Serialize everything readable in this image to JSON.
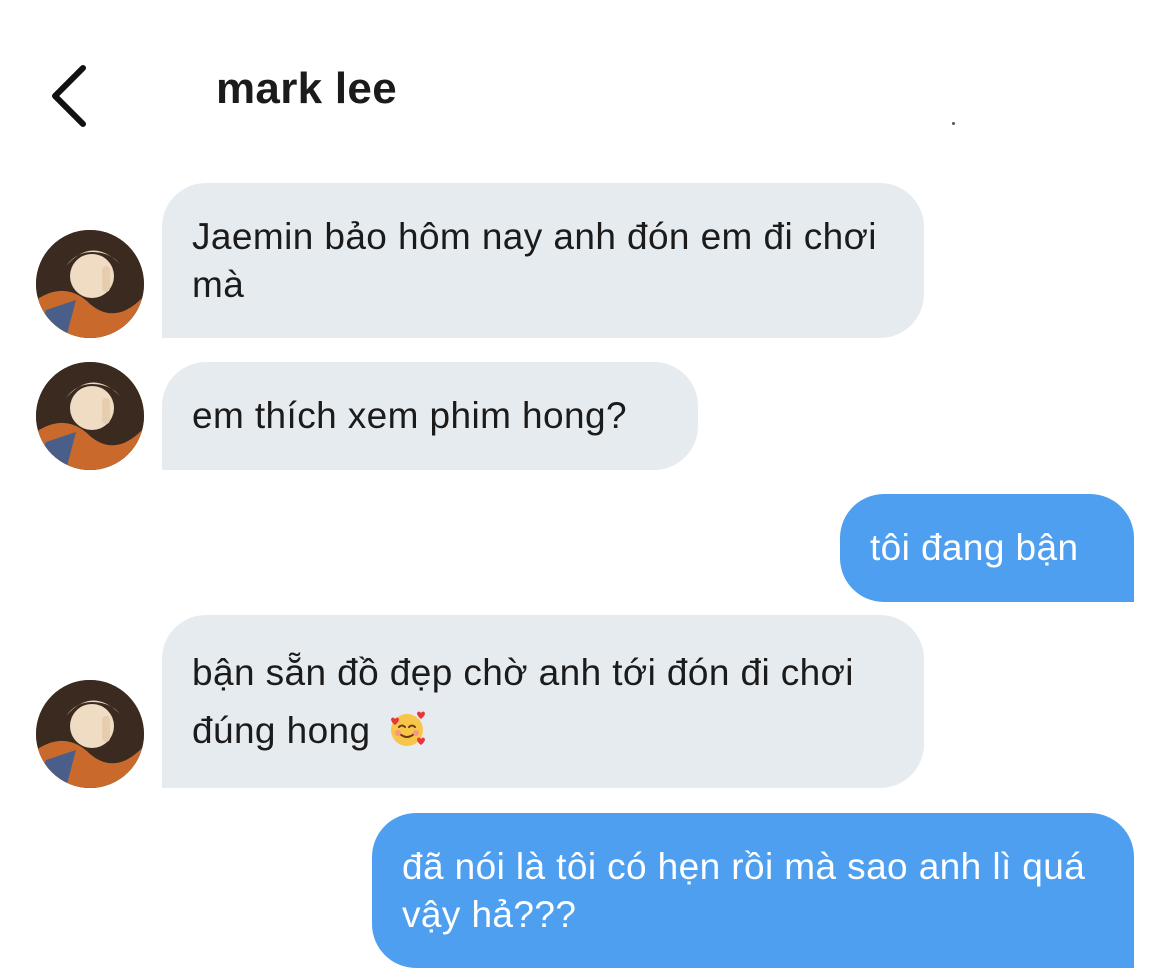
{
  "header": {
    "title": "mark lee",
    "back_icon": "chevron-left-icon"
  },
  "messages": [
    {
      "from": "contact",
      "text": "Jaemin bảo hôm nay anh đón em đi chơi mà"
    },
    {
      "from": "contact",
      "text": "em thích xem phim hong?"
    },
    {
      "from": "me",
      "text": "tôi đang bận"
    },
    {
      "from": "contact",
      "text": "bận sẵn đồ đẹp chờ anh tới đón đi chơi đúng hong",
      "emoji": "smiling-face-with-hearts-icon"
    },
    {
      "from": "me",
      "text": "đã nói là tôi có hẹn rồi mà sao anh lì quá vậy hả???"
    }
  ],
  "colors": {
    "incoming_bubble": "#e6ebef",
    "outgoing_bubble": "#4e9ff0",
    "outgoing_text": "#ffffff",
    "text": "#1b1b1b"
  }
}
